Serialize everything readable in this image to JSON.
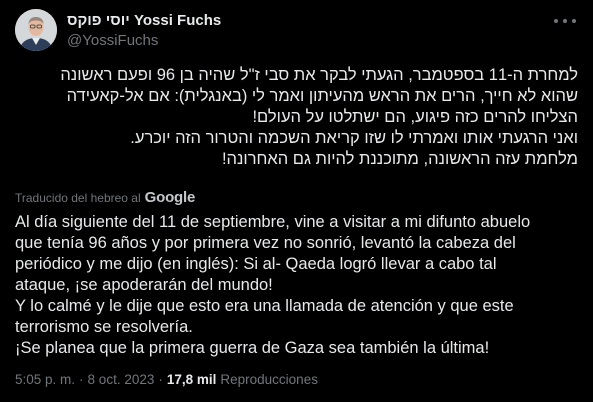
{
  "author": {
    "display_name": "יוסי פוקס Yossi Fuchs",
    "handle": "@YossiFuchs"
  },
  "original_text": {
    "lines": [
      "למחרת ה-11 בספטמבר, הגעתי לבקר את סבי ז\"ל שהיה בן 96 ופעם ראשונה",
      "שהוא לא חייך, הרים את הראש מהעיתון ואמר לי (באנגלית): אם אל-קאעידה",
      "הצליחו להרים כזה פיגוע, הם ישתלטו על העולם!",
      "ואני הרגעתי אותו ואמרתי לו שזו קריאת השכמה והטרור הזה יוכרע.",
      "מלחמת עזה הראשונה, מתוכננת להיות גם האחרונה!"
    ]
  },
  "translation_notice": {
    "label": "Traducido del hebreo al",
    "provider": "Google"
  },
  "translated_text": {
    "lines": [
      "Al día siguiente del 11 de septiembre, vine a visitar a mi difunto abuelo",
      "que tenía 96 años y por primera vez no sonrió, levantó la cabeza del",
      "periódico y me dijo (en inglés): Si al- Qaeda logró llevar a cabo tal",
      "ataque, ¡se apoderarán del mundo!",
      "Y lo calmé y le dije que esto era una llamada de atención y que este",
      "terrorismo se resolvería.",
      "¡Se planea que la primera guerra de Gaza sea también la última!"
    ]
  },
  "meta": {
    "time": "5:05 p. m.",
    "separator": "·",
    "date": "8 oct. 2023",
    "views_count": "17,8 mil",
    "views_label": "Reproducciones"
  },
  "icons": {
    "more": "more-horizontal-icon"
  },
  "colors": {
    "background": "#000000",
    "text": "#e7e9ea",
    "secondary": "#71767b"
  }
}
